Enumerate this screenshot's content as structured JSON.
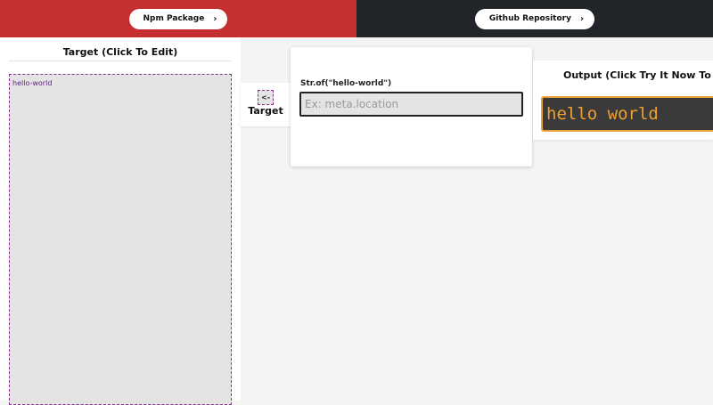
{
  "header": {
    "npm_label": "Npm Package",
    "github_label": "Github Repository",
    "colors": {
      "left_bg": "#c62f2f",
      "right_bg": "#212529"
    }
  },
  "target_panel": {
    "title": "Target (Click To Edit)",
    "content": "hello-world"
  },
  "target_control": {
    "arrow_label": "<-",
    "label": "Target"
  },
  "editor": {
    "expression": "Str.of(\"hello-world\")",
    "input_value": "",
    "input_placeholder": "Ex: meta.location"
  },
  "output": {
    "title": "Output (Click Try It Now To Up",
    "value": "hello world",
    "colors": {
      "bg": "#3a3a3a",
      "text": "#f0a030"
    }
  },
  "icons": {
    "pill_chevron": "chevron-right-icon"
  }
}
